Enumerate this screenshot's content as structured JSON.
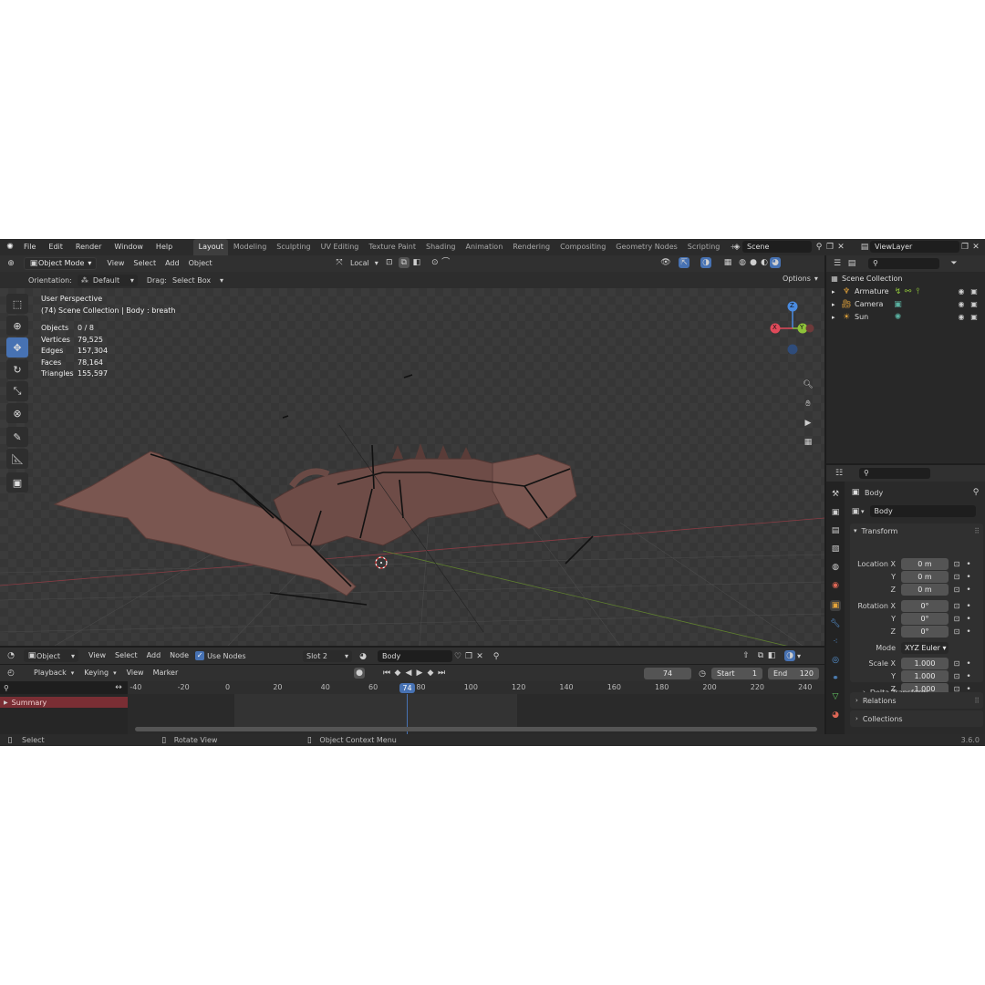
{
  "topbar": {
    "menu": [
      "File",
      "Edit",
      "Render",
      "Window",
      "Help"
    ],
    "workspaces": [
      "Layout",
      "Modeling",
      "Sculpting",
      "UV Editing",
      "Texture Paint",
      "Shading",
      "Animation",
      "Rendering",
      "Compositing",
      "Geometry Nodes",
      "Scripting"
    ],
    "active_workspace": "Layout",
    "add_tab": "+",
    "scene": "Scene",
    "view_layer": "ViewLayer"
  },
  "viewport_header": {
    "mode": "Object Mode",
    "menu": [
      "View",
      "Select",
      "Add",
      "Object"
    ],
    "transform_space": "Local",
    "options": "Options"
  },
  "tool_settings": {
    "orientation_label": "Orientation:",
    "orientation_value": "Default",
    "drag_label": "Drag:",
    "drag_value": "Select Box"
  },
  "overlay": {
    "view_name": "User Perspective",
    "context": "(74) Scene Collection | Body : breath",
    "stats": [
      {
        "label": "Objects",
        "value": "0 / 8"
      },
      {
        "label": "Vertices",
        "value": "79,525"
      },
      {
        "label": "Edges",
        "value": "157,304"
      },
      {
        "label": "Faces",
        "value": "78,164"
      },
      {
        "label": "Triangles",
        "value": "155,597"
      }
    ]
  },
  "gizmo": {
    "z": "Z",
    "y": "Y",
    "x": "X"
  },
  "shader_header": {
    "editor": "Object",
    "menu": [
      "View",
      "Select",
      "Add",
      "Node"
    ],
    "use_nodes_label": "Use Nodes",
    "slot": "Slot 2",
    "material": "Body"
  },
  "timeline": {
    "menu": [
      "Playback",
      "Keying",
      "View",
      "Marker"
    ],
    "current_frame": "74",
    "start_label": "Start",
    "start_value": "1",
    "end_label": "End",
    "end_value": "120",
    "ticks": [
      "-40",
      "-20",
      "0",
      "20",
      "40",
      "60",
      "80",
      "100",
      "120",
      "140",
      "160",
      "180",
      "200",
      "220",
      "240"
    ],
    "playhead_label": "74",
    "summary_label": "Summary"
  },
  "status_bar": {
    "items": [
      "Select",
      "Rotate View",
      "Object Context Menu"
    ],
    "version": "3.6.0"
  },
  "outliner": {
    "root": "Scene Collection",
    "items": [
      {
        "name": "Armature",
        "color": "#e3a33a"
      },
      {
        "name": "Camera",
        "color": "#e3a33a"
      },
      {
        "name": "Sun",
        "color": "#e3a33a"
      }
    ]
  },
  "properties": {
    "object_name": "Body",
    "data_name": "Body",
    "transform_title": "Transform",
    "location": {
      "label_x": "Location X",
      "x": "0 m",
      "y": "0 m",
      "z": "0 m"
    },
    "rotation": {
      "label_x": "Rotation X",
      "x": "0°",
      "y": "0°",
      "z": "0°"
    },
    "axis_y": "Y",
    "axis_z": "Z",
    "mode_label": "Mode",
    "mode_value": "XYZ Euler",
    "scale": {
      "label_x": "Scale X",
      "x": "1.000",
      "y": "1.000",
      "z": "1.000"
    },
    "delta_transform": "Delta Transform",
    "relations": "Relations",
    "collections": "Collections"
  },
  "colors": {
    "accent": "#4772b3",
    "x_axis": "#e04a5a",
    "y_axis": "#8ec23a",
    "z_axis": "#4a8be0"
  }
}
